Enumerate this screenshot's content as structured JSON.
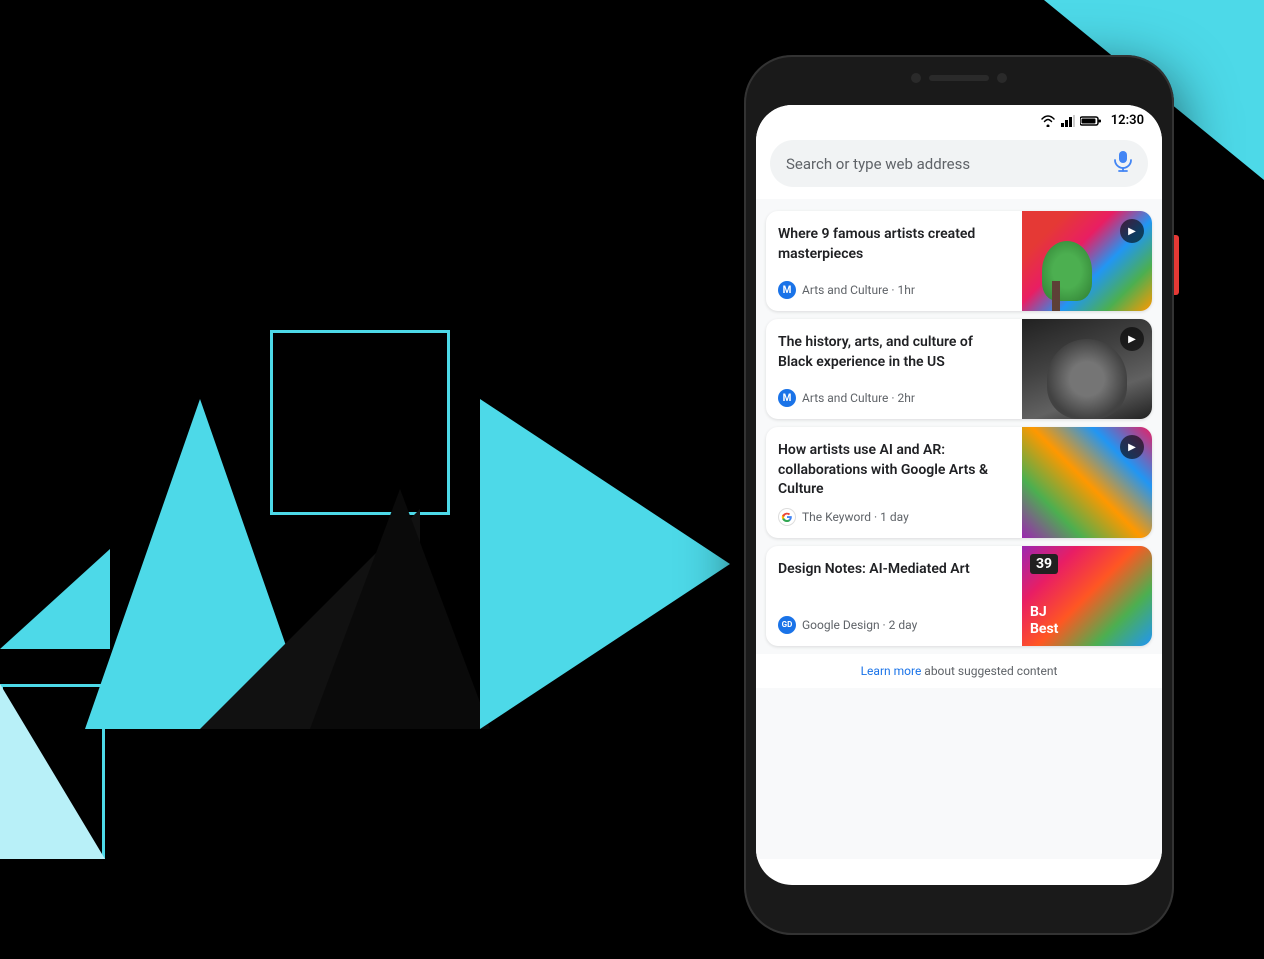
{
  "background": {
    "color": "#000000"
  },
  "phone": {
    "status_bar": {
      "time": "12:30"
    },
    "search_bar": {
      "placeholder": "Search or type web address"
    },
    "cards": [
      {
        "id": "card-1",
        "title": "Where 9 famous artists created masterpieces",
        "source_name": "Arts and Culture",
        "source_time": "1hr",
        "source_icon_type": "arts",
        "source_icon_label": "M",
        "has_play": true,
        "image_type": "colorful-tree"
      },
      {
        "id": "card-2",
        "title": "The history, arts, and culture of Black experience in the US",
        "source_name": "Arts and Culture",
        "source_time": "2hr",
        "source_icon_type": "arts",
        "source_icon_label": "M",
        "has_play": true,
        "image_type": "portrait"
      },
      {
        "id": "card-3",
        "title": "How artists use AI and AR: collaborations with Google Arts & Culture",
        "source_name": "The Keyword",
        "source_time": "1 day",
        "source_icon_type": "google",
        "source_icon_label": "G",
        "has_play": true,
        "image_type": "geometric"
      },
      {
        "id": "card-4",
        "title": "Design Notes: AI-Mediated Art",
        "source_name": "Google Design",
        "source_time": "2 day",
        "source_icon_type": "gd",
        "source_icon_label": "GD",
        "has_play": false,
        "image_type": "abstract",
        "badge_number": "39",
        "badge_text_line1": "BJ",
        "badge_text_line2": "Best"
      }
    ],
    "footer": {
      "text_before_link": "",
      "link_text": "Learn more",
      "text_after_link": " about suggested content"
    }
  }
}
